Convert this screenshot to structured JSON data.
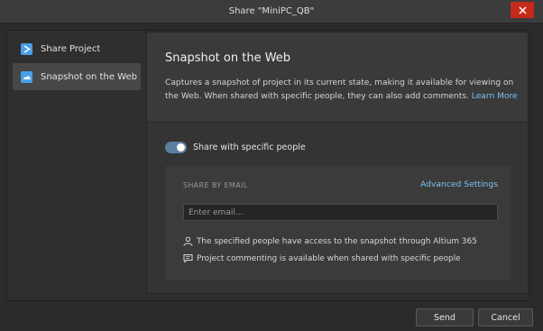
{
  "window": {
    "title": "Share \"MiniPC_QB\"",
    "close_icon": "close-icon"
  },
  "sidebar": {
    "items": [
      {
        "label": "Share Project",
        "icon": "share-project-icon",
        "active": false
      },
      {
        "label": "Snapshot on the Web",
        "icon": "snapshot-web-icon",
        "active": true
      }
    ]
  },
  "main": {
    "title": "Snapshot on the Web",
    "description": "Captures a snapshot of project in its current state, making it available for viewing on the Web. When shared with specific people, they can also add comments.",
    "learn_more": "Learn More",
    "toggle": {
      "label": "Share with specific people",
      "on": true
    },
    "email_section": {
      "label": "SHARE BY EMAIL",
      "advanced": "Advanced Settings",
      "input_placeholder": "Enter email...",
      "input_value": "",
      "notes": [
        {
          "icon": "person-icon",
          "text": "The specified people have access to the snapshot through Altium 365"
        },
        {
          "icon": "comment-icon",
          "text": "Project commenting is available when shared with specific people"
        }
      ]
    }
  },
  "footer": {
    "send_label": "Send",
    "cancel_label": "Cancel"
  },
  "colors": {
    "accent": "#7cc0f0",
    "toggle_on": "#5c7e9e",
    "close_red": "#c42b1c",
    "icon_blue": "#4a9fe8"
  }
}
